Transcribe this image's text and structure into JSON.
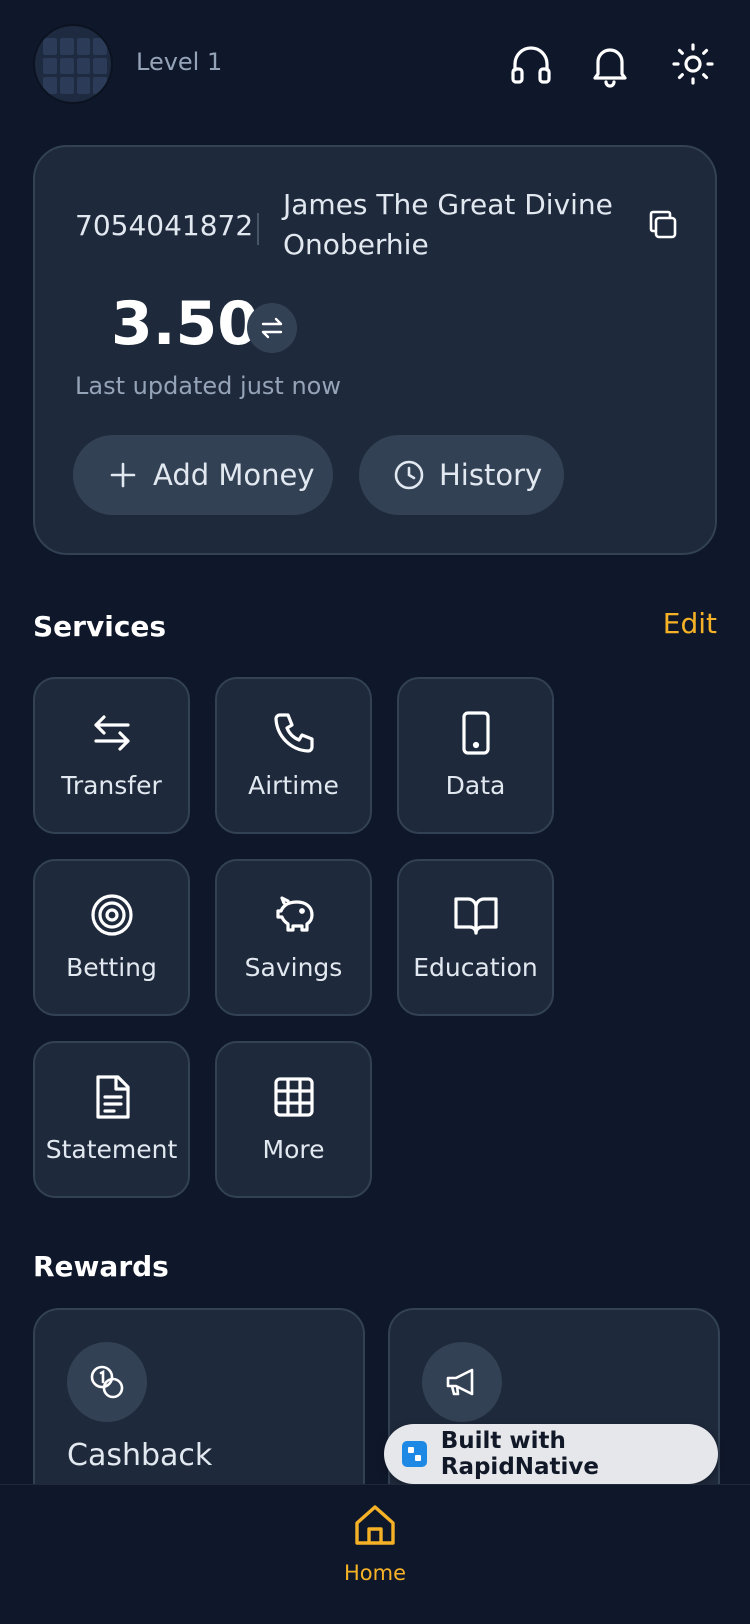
{
  "header": {
    "level": "Level 1",
    "icons": [
      "headset-icon",
      "bell-icon",
      "sun-icon"
    ]
  },
  "wallet": {
    "account_number": "7054041872",
    "account_name": "James The Great Divine Onoberhie",
    "balance": "3.50",
    "last_updated": "Last updated just now",
    "add_money_label": "Add Money",
    "history_label": "History"
  },
  "services": {
    "title": "Services",
    "edit_label": "Edit",
    "items": [
      {
        "label": "Transfer",
        "icon": "transfer-arrows-icon"
      },
      {
        "label": "Airtime",
        "icon": "phone-icon"
      },
      {
        "label": "Data",
        "icon": "mobile-device-icon"
      },
      {
        "label": "Betting",
        "icon": "target-icon"
      },
      {
        "label": "Savings",
        "icon": "piggy-bank-icon"
      },
      {
        "label": "Education",
        "icon": "book-icon"
      },
      {
        "label": "Statement",
        "icon": "document-icon"
      },
      {
        "label": "More",
        "icon": "grid-icon"
      }
    ]
  },
  "rewards": {
    "title": "Rewards",
    "items": [
      {
        "label": "Cashback",
        "icon": "coins-icon"
      },
      {
        "label": "",
        "icon": "megaphone-icon"
      }
    ]
  },
  "badge": {
    "label": "Built with RapidNative"
  },
  "nav": {
    "home_label": "Home"
  },
  "colors": {
    "background": "#0f172a",
    "card": "#1e293b",
    "border": "#334155",
    "accent": "#f5b227",
    "muted_text": "#94a3b8"
  }
}
